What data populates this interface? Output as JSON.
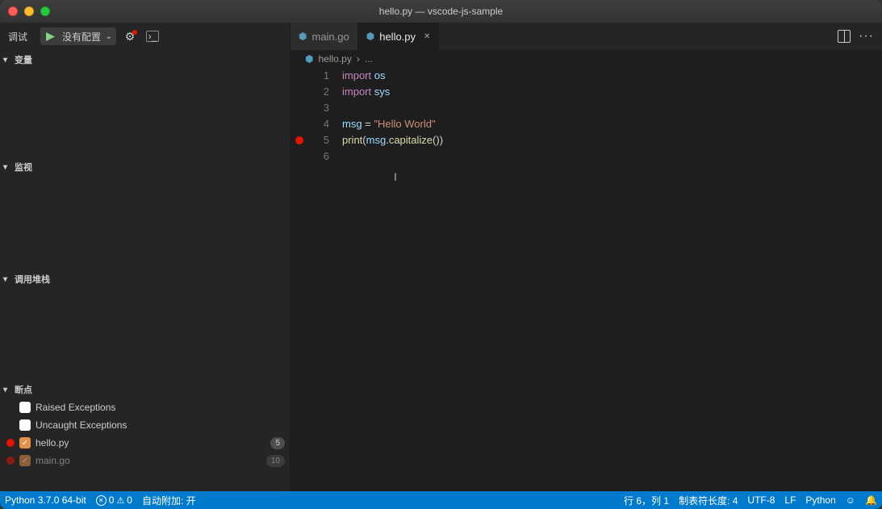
{
  "titlebar": {
    "title": "hello.py — vscode-js-sample"
  },
  "debug": {
    "label": "调试",
    "play_icon": "play-icon",
    "config_label": "没有配置",
    "gear_icon": "gear-icon",
    "console_icon": "debug-console-icon"
  },
  "sections": {
    "variables": "变量",
    "watch": "监视",
    "callstack": "调用堆栈",
    "breakpoints": "断点"
  },
  "breakpoints": [
    {
      "dot": false,
      "check_style": "white",
      "checked": false,
      "label": "Raised Exceptions",
      "count": null
    },
    {
      "dot": false,
      "check_style": "white",
      "checked": false,
      "label": "Uncaught Exceptions",
      "count": null
    },
    {
      "dot": true,
      "check_style": "orange",
      "checked": true,
      "label": "hello.py",
      "count": "5"
    },
    {
      "dot": true,
      "check_style": "orange",
      "checked": true,
      "label": "main.go",
      "count": "10",
      "faded": true
    }
  ],
  "tabs": [
    {
      "icon": "go-file-icon",
      "icon_color": "#519aba",
      "label": "main.go",
      "active": false
    },
    {
      "icon": "python-file-icon",
      "icon_color": "#519aba",
      "label": "hello.py",
      "active": true
    }
  ],
  "breadcrumb": {
    "file_icon": "python-file-icon",
    "file": "hello.py",
    "sep": "›",
    "rest": "..."
  },
  "code": {
    "lines": [
      {
        "n": 1,
        "bp": false,
        "tokens": [
          [
            "kw",
            "import"
          ],
          [
            "",
            " "
          ],
          [
            "var",
            "os"
          ]
        ]
      },
      {
        "n": 2,
        "bp": false,
        "tokens": [
          [
            "kw",
            "import"
          ],
          [
            "",
            " "
          ],
          [
            "var",
            "sys"
          ]
        ]
      },
      {
        "n": 3,
        "bp": false,
        "tokens": []
      },
      {
        "n": 4,
        "bp": false,
        "tokens": [
          [
            "var",
            "msg"
          ],
          [
            "",
            " = "
          ],
          [
            "str",
            "\"Hello World\""
          ]
        ]
      },
      {
        "n": 5,
        "bp": true,
        "tokens": [
          [
            "fn",
            "print"
          ],
          [
            "",
            "("
          ],
          [
            "var",
            "msg"
          ],
          [
            "",
            "."
          ],
          [
            "fn",
            "capitalize"
          ],
          [
            "",
            "())"
          ]
        ]
      },
      {
        "n": 6,
        "bp": false,
        "tokens": []
      }
    ],
    "active_line": 6
  },
  "statusbar": {
    "python": "Python 3.7.0 64-bit",
    "errors": "0",
    "warnings": "0",
    "autoattach": "自动附加: 开",
    "lncol": "行 6，列 1",
    "tabsize": "制表符长度: 4",
    "encoding": "UTF-8",
    "eol": "LF",
    "language": "Python",
    "feedback_icon": "smiley-icon",
    "bell_icon": "bell-icon"
  }
}
